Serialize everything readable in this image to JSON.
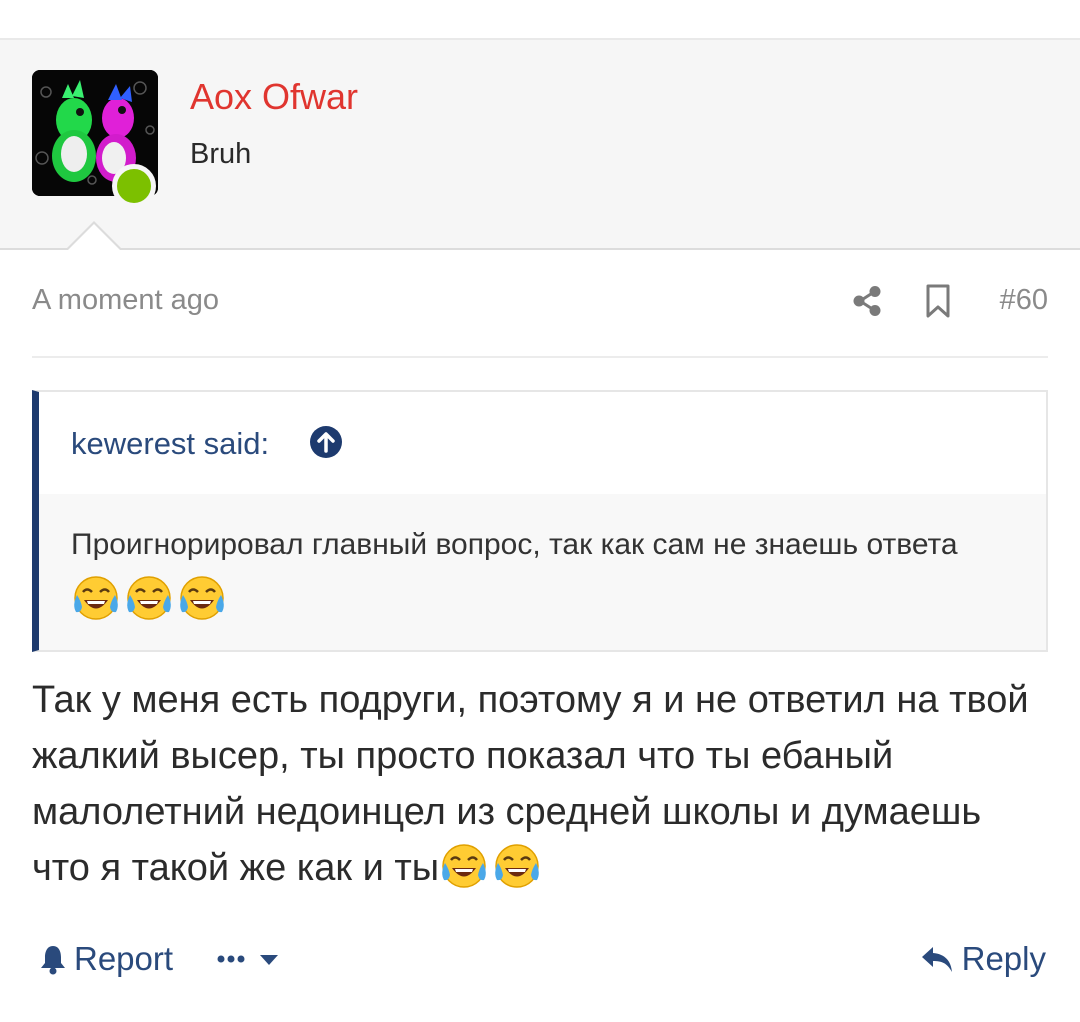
{
  "user": {
    "name": "Aox Ofwar",
    "title": "Bruh",
    "status": "online",
    "name_color": "#e0352f",
    "status_color": "#7cc000"
  },
  "post": {
    "time": "A moment ago",
    "number": "#60"
  },
  "quote": {
    "author_label": "kewerest said:",
    "text": "Проигнорировал главный вопрос, так как сам не знаешь ответа",
    "emoji_count": 3
  },
  "message": {
    "text": "Так у меня есть подруги, поэтому я и не ответил на твой жалкий высер, ты просто показал что ты ебаный малолетний недоинцел из средней школы и думаешь что я такой же как и ты",
    "emoji_count": 2
  },
  "actions": {
    "report_label": "Report",
    "reply_label": "Reply"
  },
  "icons": {
    "share": "share-icon",
    "bookmark": "bookmark-icon",
    "quote_jump": "arrow-up-circle-icon",
    "report": "bell-icon",
    "more": "more-dots-icon",
    "reply": "reply-arrow-icon",
    "emoji": "tears-of-joy-emoji"
  },
  "colors": {
    "link": "#2a4a7c",
    "quote_bar": "#1d3a6e",
    "muted": "#8a8a8a"
  }
}
